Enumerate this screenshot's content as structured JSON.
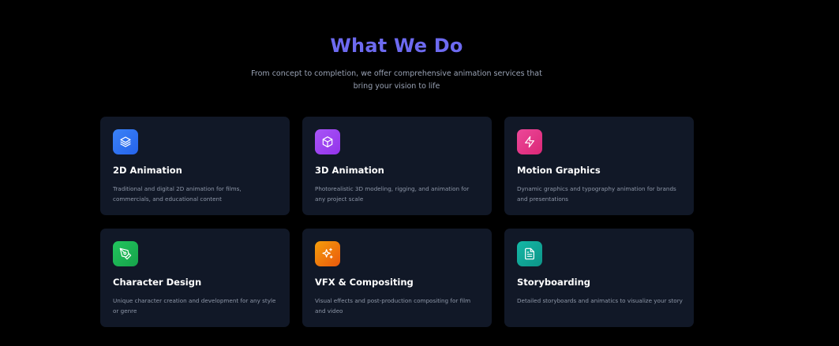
{
  "section": {
    "title": "What We Do",
    "subtitle": "From concept to completion, we offer comprehensive animation services that bring your vision to life"
  },
  "services": [
    {
      "title": "2D Animation",
      "description": "Traditional and digital 2D animation for films, commercials, and educational content",
      "icon": "layers-icon",
      "gradient": [
        "#3b82f6",
        "#2563eb"
      ]
    },
    {
      "title": "3D Animation",
      "description": "Photorealistic 3D modeling, rigging, and animation for any project scale",
      "icon": "cube-icon",
      "gradient": [
        "#a855f7",
        "#9333ea"
      ]
    },
    {
      "title": "Motion Graphics",
      "description": "Dynamic graphics and typography animation for brands and presentations",
      "icon": "lightning-icon",
      "gradient": [
        "#ec4899",
        "#db2777"
      ]
    },
    {
      "title": "Character Design",
      "description": "Unique character creation and development for any style or genre",
      "icon": "pen-tool-icon",
      "gradient": [
        "#22c55e",
        "#16a34a"
      ]
    },
    {
      "title": "VFX & Compositing",
      "description": "Visual effects and post-production compositing for film and video",
      "icon": "sparkles-icon",
      "gradient": [
        "#f59e0b",
        "#ea580c"
      ]
    },
    {
      "title": "Storyboarding",
      "description": "Detailed storyboards and animatics to visualize your story",
      "icon": "document-icon",
      "gradient": [
        "#14b8a6",
        "#0d9488"
      ]
    }
  ]
}
